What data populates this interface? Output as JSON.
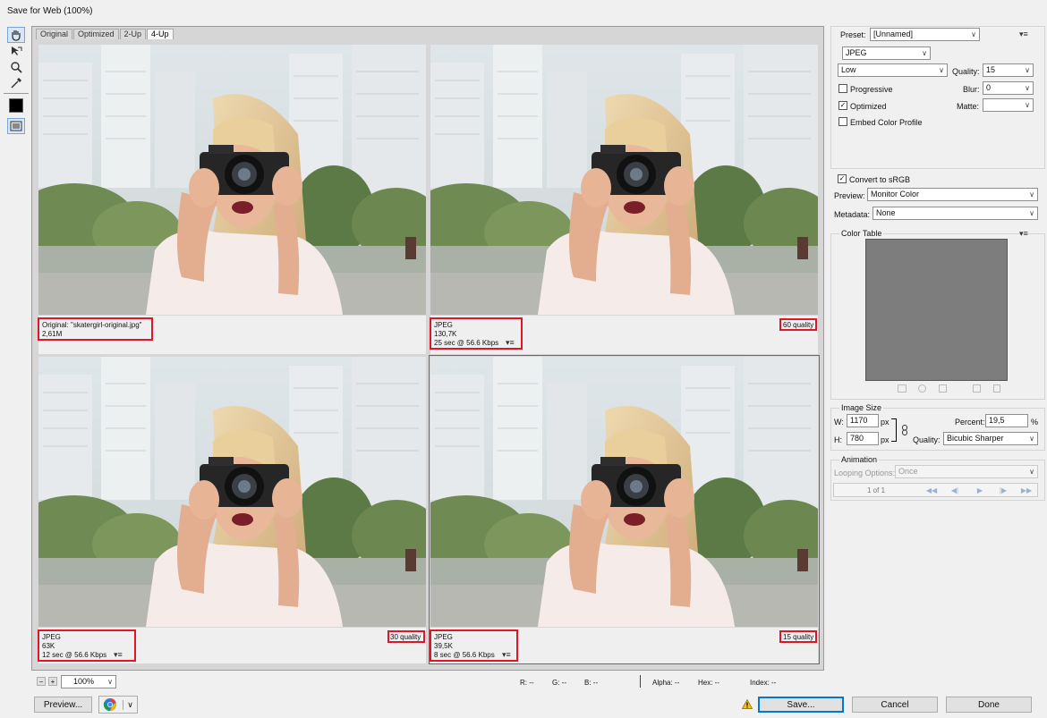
{
  "window": {
    "title": "Save for Web (100%)"
  },
  "tabs": [
    "Original",
    "Optimized",
    "2-Up",
    "4-Up"
  ],
  "panes": [
    {
      "line1": "Original: \"skatergirl-original.jpg\"",
      "line2": "2,61M",
      "line3": "",
      "quality": ""
    },
    {
      "line1": "JPEG",
      "line2": "130,7K",
      "line3": "25 sec @ 56.6 Kbps",
      "quality": "60 quality"
    },
    {
      "line1": "JPEG",
      "line2": "63K",
      "line3": "12 sec @ 56.6 Kbps",
      "quality": "30 quality"
    },
    {
      "line1": "JPEG",
      "line2": "39,5K",
      "line3": "8 sec @ 56.6 Kbps",
      "quality": "15 quality"
    }
  ],
  "bottom": {
    "zoom": "100%",
    "r": "R: --",
    "g": "G: --",
    "b": "B: --",
    "alpha": "Alpha: --",
    "hex": "Hex: --",
    "index": "Index: --",
    "preview_btn": "Preview...",
    "save_btn": "Save...",
    "cancel_btn": "Cancel",
    "done_btn": "Done"
  },
  "settings": {
    "preset_label": "Preset:",
    "preset_value": "[Unnamed]",
    "format": "JPEG",
    "compression": "Low",
    "quality_label": "Quality:",
    "quality_value": "15",
    "progressive": "Progressive",
    "blur_label": "Blur:",
    "blur_value": "0",
    "optimized": "Optimized",
    "matte_label": "Matte:",
    "embed_profile": "Embed Color Profile",
    "convert_srgb": "Convert to sRGB",
    "preview_label": "Preview:",
    "preview_value": "Monitor Color",
    "metadata_label": "Metadata:",
    "metadata_value": "None",
    "color_table_label": "Color Table"
  },
  "checks": {
    "progressive": false,
    "optimized": true,
    "embed_profile": false,
    "convert_srgb": true
  },
  "image_size": {
    "label": "Image Size",
    "w_label": "W:",
    "w_value": "1170",
    "w_unit": "px",
    "h_label": "H:",
    "h_value": "780",
    "h_unit": "px",
    "percent_label": "Percent:",
    "percent_value": "19,5",
    "percent_unit": "%",
    "quality_label": "Quality:",
    "quality_value": "Bicubic Sharper"
  },
  "animation": {
    "label": "Animation",
    "looping_label": "Looping Options:",
    "looping_value": "Once",
    "frame": "1 of 1"
  },
  "colors": {
    "highlight": "#e0152a",
    "accent": "#0078d7"
  }
}
